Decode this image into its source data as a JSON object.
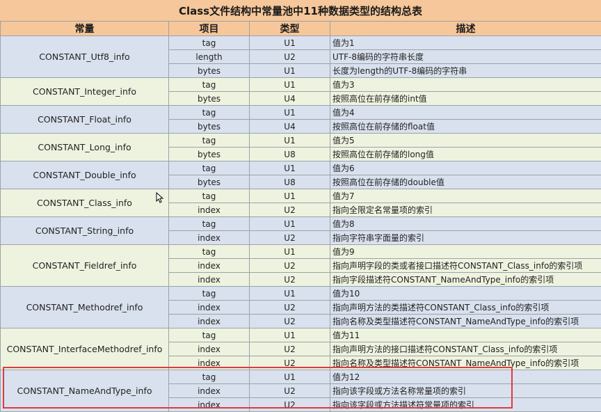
{
  "title": "Class文件结构中常量池中11种数据类型的结构总表",
  "headers": [
    "常量",
    "项目",
    "类型",
    "描述"
  ],
  "groups": [
    {
      "name": "CONSTANT_Utf8_info",
      "rows": [
        {
          "item": "tag",
          "type": "U1",
          "desc": "值为1"
        },
        {
          "item": "length",
          "type": "U2",
          "desc": "UTF-8编码的字符串长度"
        },
        {
          "item": "bytes",
          "type": "U1",
          "desc": "长度为length的UTF-8编码的字符串"
        }
      ]
    },
    {
      "name": "CONSTANT_Integer_info",
      "rows": [
        {
          "item": "tag",
          "type": "U1",
          "desc": "值为3"
        },
        {
          "item": "bytes",
          "type": "U4",
          "desc": "按照高位在前存储的int值"
        }
      ]
    },
    {
      "name": "CONSTANT_Float_info",
      "rows": [
        {
          "item": "tag",
          "type": "U1",
          "desc": "值为4"
        },
        {
          "item": "bytes",
          "type": "U4",
          "desc": "按照高位在前存储的float值"
        }
      ]
    },
    {
      "name": "CONSTANT_Long_info",
      "rows": [
        {
          "item": "tag",
          "type": "U1",
          "desc": "值为5"
        },
        {
          "item": "bytes",
          "type": "U8",
          "desc": "按照高位在前存储的long值"
        }
      ]
    },
    {
      "name": "CONSTANT_Double_info",
      "rows": [
        {
          "item": "tag",
          "type": "U1",
          "desc": "值为6"
        },
        {
          "item": "bytes",
          "type": "U8",
          "desc": "按照高位在前存储的double值"
        }
      ]
    },
    {
      "name": "CONSTANT_Class_info",
      "rows": [
        {
          "item": "tag",
          "type": "U1",
          "desc": "值为7"
        },
        {
          "item": "index",
          "type": "U2",
          "desc": "指向全限定名常量项的索引"
        }
      ]
    },
    {
      "name": "CONSTANT_String_info",
      "rows": [
        {
          "item": "tag",
          "type": "U1",
          "desc": "值为8"
        },
        {
          "item": "index",
          "type": "U2",
          "desc": "指向字符串字面量的索引"
        }
      ]
    },
    {
      "name": "CONSTANT_Fieldref_info",
      "rows": [
        {
          "item": "tag",
          "type": "U1",
          "desc": "值为9"
        },
        {
          "item": "index",
          "type": "U2",
          "desc": "指向声明字段的类或者接口描述符CONSTANT_Class_info的索引项"
        },
        {
          "item": "index",
          "type": "U2",
          "desc": "指向字段描述符CONSTANT_NameAndType_info的索引项"
        }
      ]
    },
    {
      "name": "CONSTANT_Methodref_info",
      "rows": [
        {
          "item": "tag",
          "type": "U1",
          "desc": "值为10"
        },
        {
          "item": "index",
          "type": "U2",
          "desc": "指向声明方法的类描述符CONSTANT_Class_info的索引项"
        },
        {
          "item": "index",
          "type": "U2",
          "desc": "指向名称及类型描述符CONSTANT_NameAndType_info的索引项"
        }
      ]
    },
    {
      "name": "CONSTANT_InterfaceMethodref_info",
      "rows": [
        {
          "item": "tag",
          "type": "U1",
          "desc": "值为11"
        },
        {
          "item": "index",
          "type": "U2",
          "desc": "指向声明方法的接口描述符CONSTANT_Class_info的索引项"
        },
        {
          "item": "index",
          "type": "U2",
          "desc": "指向名称及类型描述符CONSTANT_NameAndType_info的索引项"
        }
      ]
    },
    {
      "name": "CONSTANT_NameAndType_info",
      "rows": [
        {
          "item": "tag",
          "type": "U1",
          "desc": "值为12"
        },
        {
          "item": "index",
          "type": "U2",
          "desc": "指向该字段或方法名称常量项的索引"
        },
        {
          "item": "index",
          "type": "U2",
          "desc": "指向该字段或方法描述符常量项的索引"
        }
      ]
    }
  ],
  "colors": {
    "header_bg": "#f6c79a",
    "row_blue": "#d9e1ee",
    "row_green": "#eef3df",
    "highlight": "#e0393e"
  },
  "icons": {
    "cursor": "mouse-pointer-icon"
  }
}
